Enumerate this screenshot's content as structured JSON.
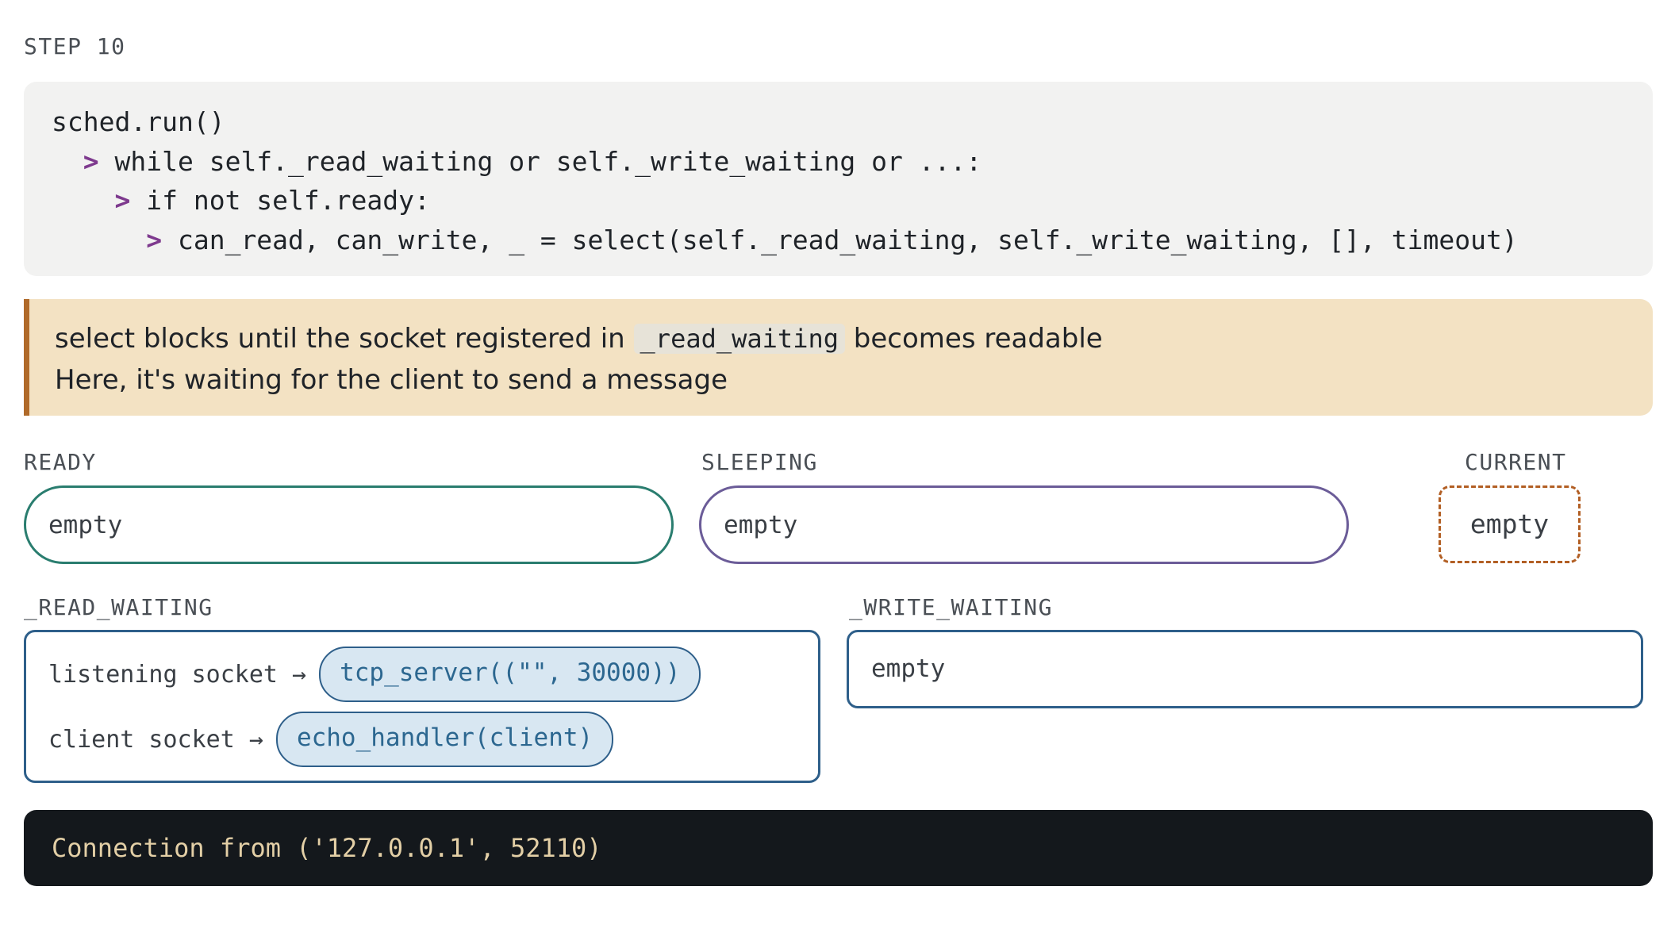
{
  "step": {
    "label": "STEP 10"
  },
  "code": {
    "arrow": ">",
    "lines": [
      {
        "indent": "",
        "arrow": false,
        "text": "sched.run()"
      },
      {
        "indent": "  ",
        "arrow": true,
        "text": "while self._read_waiting or self._write_waiting or ...:"
      },
      {
        "indent": "    ",
        "arrow": true,
        "text": "if not self.ready:"
      },
      {
        "indent": "      ",
        "arrow": true,
        "text": "can_read, can_write, _ = select(self._read_waiting, self._write_waiting, [], timeout)"
      }
    ]
  },
  "note": {
    "line1_before": "select blocks until the socket registered in",
    "line1_code": "_read_waiting",
    "line1_after": "becomes readable",
    "line2": "Here, it's waiting for the client to send a message"
  },
  "ready": {
    "label": "READY",
    "value": "empty"
  },
  "sleeping": {
    "label": "SLEEPING",
    "value": "empty"
  },
  "current": {
    "label": "CURRENT",
    "value": "empty"
  },
  "read_waiting": {
    "label": "_READ_WAITING",
    "entries": [
      {
        "key": "listening socket →",
        "task": "tcp_server((\"\", 30000))"
      },
      {
        "key": "client socket →",
        "task": "echo_handler(client)"
      }
    ]
  },
  "write_waiting": {
    "label": "_WRITE_WAITING",
    "value": "empty"
  },
  "console": {
    "output": "Connection from ('127.0.0.1', 52110)"
  },
  "colors": {
    "ready_border": "#2a7d6f",
    "sleeping_border": "#6b5c98",
    "current_border": "#b25f24",
    "waiting_border": "#2e5f8a",
    "arrow": "#7e3a8e",
    "note_bg": "#f3e2c3",
    "console_bg": "#14181c"
  }
}
